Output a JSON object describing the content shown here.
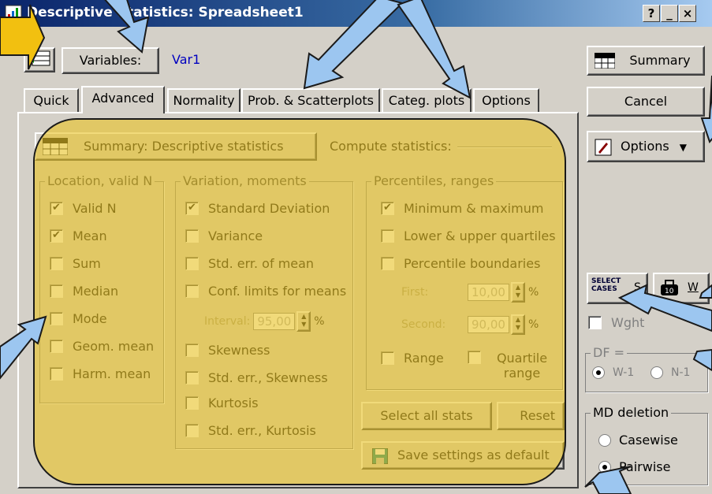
{
  "window": {
    "title": "Descriptive Statistics: Spreadsheet1",
    "help_label": "?",
    "minimize_label": "_",
    "close_label": "×"
  },
  "variables": {
    "button_label": "Variables:",
    "value": "Var1"
  },
  "tabs": [
    {
      "label": "Quick"
    },
    {
      "label": "Advanced"
    },
    {
      "label": "Normality"
    },
    {
      "label": "Prob. & Scatterplots"
    },
    {
      "label": "Categ. plots"
    },
    {
      "label": "Options"
    }
  ],
  "active_tab": "Advanced",
  "summary_desc_button": "Summary: Descriptive statistics",
  "compute_statistics_label": "Compute statistics:",
  "location_group": {
    "title": "Location, valid N",
    "items": [
      {
        "label": "Valid N",
        "checked": "✔"
      },
      {
        "label": "Mean",
        "checked": "✔"
      },
      {
        "label": "Sum",
        "checked": ""
      },
      {
        "label": "Median",
        "checked": ""
      },
      {
        "label": "Mode",
        "checked": ""
      },
      {
        "label": "Geom. mean",
        "checked": ""
      },
      {
        "label": "Harm. mean",
        "checked": ""
      }
    ]
  },
  "variation_group": {
    "title": "Variation, moments",
    "items": [
      {
        "label": "Standard Deviation",
        "checked": "✔"
      },
      {
        "label": "Variance",
        "checked": ""
      },
      {
        "label": "Std. err. of mean",
        "checked": ""
      },
      {
        "label": "Conf. limits for means",
        "checked": ""
      },
      {
        "label": "Skewness",
        "checked": ""
      },
      {
        "label": "Std. err., Skewness",
        "checked": ""
      },
      {
        "label": "Kurtosis",
        "checked": ""
      },
      {
        "label": "Std. err., Kurtosis",
        "checked": ""
      }
    ],
    "interval_label": "Interval:",
    "interval_value": "95,00",
    "percent": "%"
  },
  "percentiles_group": {
    "title": "Percentiles, ranges",
    "items": [
      {
        "label": "Minimum & maximum",
        "checked": "✔"
      },
      {
        "label": "Lower & upper quartiles",
        "checked": ""
      },
      {
        "label": "Percentile boundaries",
        "checked": ""
      }
    ],
    "first_label": "First:",
    "first_value": "10,00",
    "second_label": "Second:",
    "second_value": "90,00",
    "percent": "%",
    "range_label": "Range",
    "quartile_range_label": "Quartile range"
  },
  "select_all_button": "Select all stats",
  "reset_button": "Reset",
  "save_settings_button": "Save settings as default",
  "right_panel": {
    "summary_button": "Summary",
    "cancel_button": "Cancel",
    "options_button": "Options",
    "select_cases_label": "SELECT CASES",
    "s_label": "S",
    "w_label": "W",
    "weight_label": "Wght",
    "df_label": "DF =",
    "df_options": [
      "W-1",
      "N-1"
    ],
    "md_title": "MD deletion",
    "md_options": [
      {
        "label": "Casewise",
        "selected": false
      },
      {
        "label": "Pairwise",
        "selected": true
      }
    ]
  },
  "icon_summary_text": "SUMM",
  "colors": {
    "overlay": "#e8c428",
    "arrow": "#9cc6f0",
    "title_start": "#0a246a",
    "dialog_bg": "#d4d0c8"
  }
}
